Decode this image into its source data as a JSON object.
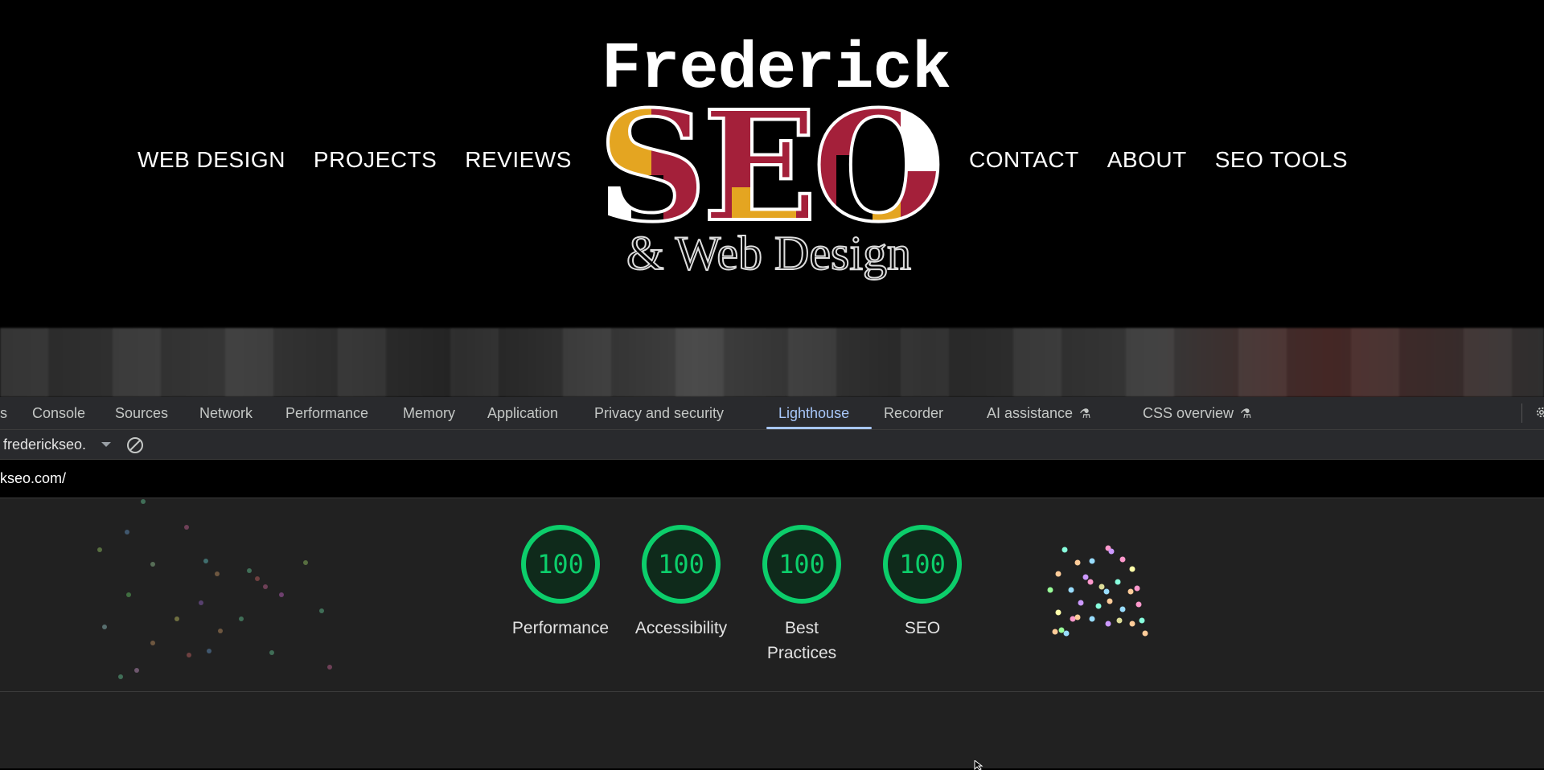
{
  "site": {
    "nav_left": [
      "WEB DESIGN",
      "PROJECTS",
      "REVIEWS"
    ],
    "nav_right": [
      "CONTACT",
      "ABOUT",
      "SEO TOOLS"
    ],
    "logo": {
      "line1": "Frederick",
      "line2": "SEO",
      "line3": "& Web Design",
      "colors": {
        "gold": "#e4a521",
        "red": "#a4203a",
        "black": "#000000",
        "white": "#ffffff"
      }
    }
  },
  "devtools": {
    "tabs": [
      {
        "label": "s",
        "active": false
      },
      {
        "label": "Console",
        "active": false
      },
      {
        "label": "Sources",
        "active": false
      },
      {
        "label": "Network",
        "active": false
      },
      {
        "label": "Performance",
        "active": false
      },
      {
        "label": "Memory",
        "active": false
      },
      {
        "label": "Application",
        "active": false
      },
      {
        "label": "Privacy and security",
        "active": false
      },
      {
        "label": "Lighthouse",
        "active": true
      },
      {
        "label": "Recorder",
        "active": false
      },
      {
        "label": "AI assistance",
        "active": false,
        "icon": "flask-icon"
      },
      {
        "label": "CSS overview",
        "active": false,
        "icon": "flask-icon"
      }
    ],
    "settings_icon": "gear-icon",
    "origin_select": "frederickseo.",
    "clear_icon": "clear-icon",
    "url": "kseo.com/",
    "accent": "#a8c7fa",
    "scores": [
      {
        "label": "Performance",
        "value": "100"
      },
      {
        "label": "Accessibility",
        "value": "100"
      },
      {
        "label": "Best Practices",
        "value": "100"
      },
      {
        "label": "SEO",
        "value": "100"
      }
    ],
    "pass_color": "#0cce6b"
  }
}
